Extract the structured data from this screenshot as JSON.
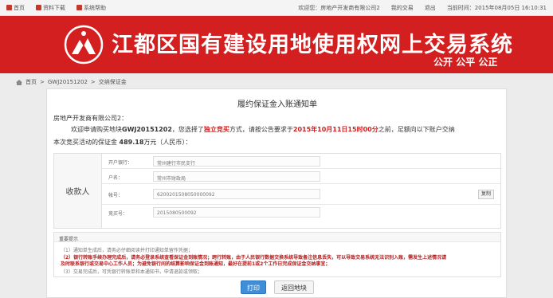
{
  "topbar": {
    "home": "首页",
    "download": "资料下载",
    "help": "系统帮助",
    "welcome": "欢迎您：房地产开发商有限公司2",
    "my_deals": "我的交易",
    "logout": "退出",
    "time_label": "当前时间：2015年08月05日 16:10:31"
  },
  "banner": {
    "title": "江都区国有建设用地使用权网上交易系统",
    "slogan": "公开 公平 公正",
    "brand_color": "#d31f1f"
  },
  "breadcrumb": {
    "home": "首页",
    "sep1": ">",
    "land": "GWJ20151202",
    "sep2": ">",
    "current": "交纳保证金"
  },
  "notice_title": "履约保证金入账通知单",
  "greeting": "房地产开发商有限公司2：",
  "body": {
    "a1": "欢迎申请购买地块",
    "land_no": "GWJ20151202",
    "a2": "，您选择了",
    "mode": "独立竞买",
    "a3": "方式，请按公告要求于",
    "deadline": "2015年10月11日15时00分",
    "a4": "之前，足额向以下账户交纳",
    "b1": "本次竞买活动的保证金",
    "amount": "489.18",
    "b2": "万元（人民币）："
  },
  "account": {
    "label": "收款人",
    "rows": [
      {
        "key": "开户银行：",
        "value": "常州建行市民支行"
      },
      {
        "key": "户名：",
        "value": "常州市财政局"
      },
      {
        "key": "帐号：",
        "value": "6200201508050000092"
      },
      {
        "key": "竞买号：",
        "value": "2015080500092"
      }
    ],
    "copy": "复制"
  },
  "tips": {
    "header": "重要提示",
    "t1": "（1）通知单生成后，请务必仔细阅读并打印通知单留作凭据；",
    "t2": "（2）银行转账手续办理完成后，请务必登录系统查看保证金到账情况；跨行转账，由于人民银行数据交换系统导致备注信息丢失，可以导致交易系统无法识别入账，需发生上述情况请",
    "t3": "及时联系银行或交易中心工作人员；为避免银行间的结算影响保证金到账通知，最好在提前1或2个工作日完成保证金交纳事宜；",
    "t4": "（3）交易完成后，可凭银行转账单和本通知书，申请退款或领取；"
  },
  "buttons": {
    "print": "打印",
    "back": "返回地块"
  }
}
